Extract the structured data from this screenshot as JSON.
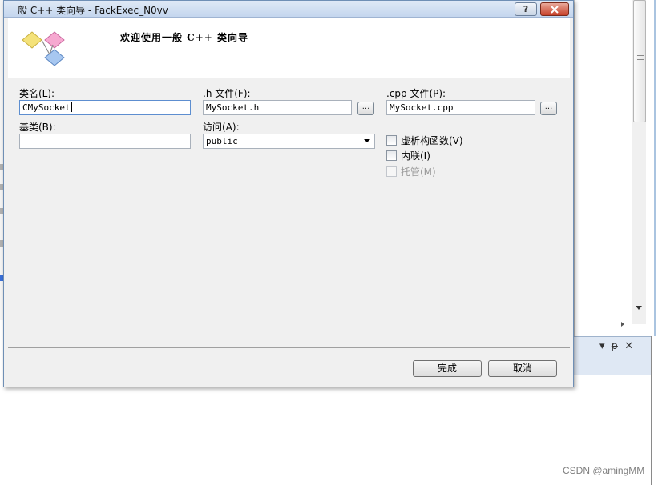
{
  "dialog": {
    "title": "一般 C++ 类向导 - FackExec_N0vv",
    "help_label": "?",
    "close_icon": "close-icon",
    "banner_title": "欢迎使用一般 C++ 类向导"
  },
  "form": {
    "class_name_label": "类名(L):",
    "class_name_value": "CMySocket",
    "h_file_label": ".h 文件(F):",
    "h_file_value": "MySocket.h",
    "cpp_file_label": ".cpp 文件(P):",
    "cpp_file_value": "MySocket.cpp",
    "base_class_label": "基类(B):",
    "base_class_value": "",
    "access_label": "访问(A):",
    "access_value": "public",
    "browse_label": "...",
    "virtual_destructor_label": "虚析构函数(V)",
    "inline_label": "内联(I)",
    "managed_label": "托管(M)"
  },
  "buttons": {
    "finish": "完成",
    "cancel": "取消"
  },
  "background": {
    "panel_controls": [
      "▾",
      "ᵽ",
      "✕"
    ]
  },
  "watermark": "CSDN @amingMM"
}
